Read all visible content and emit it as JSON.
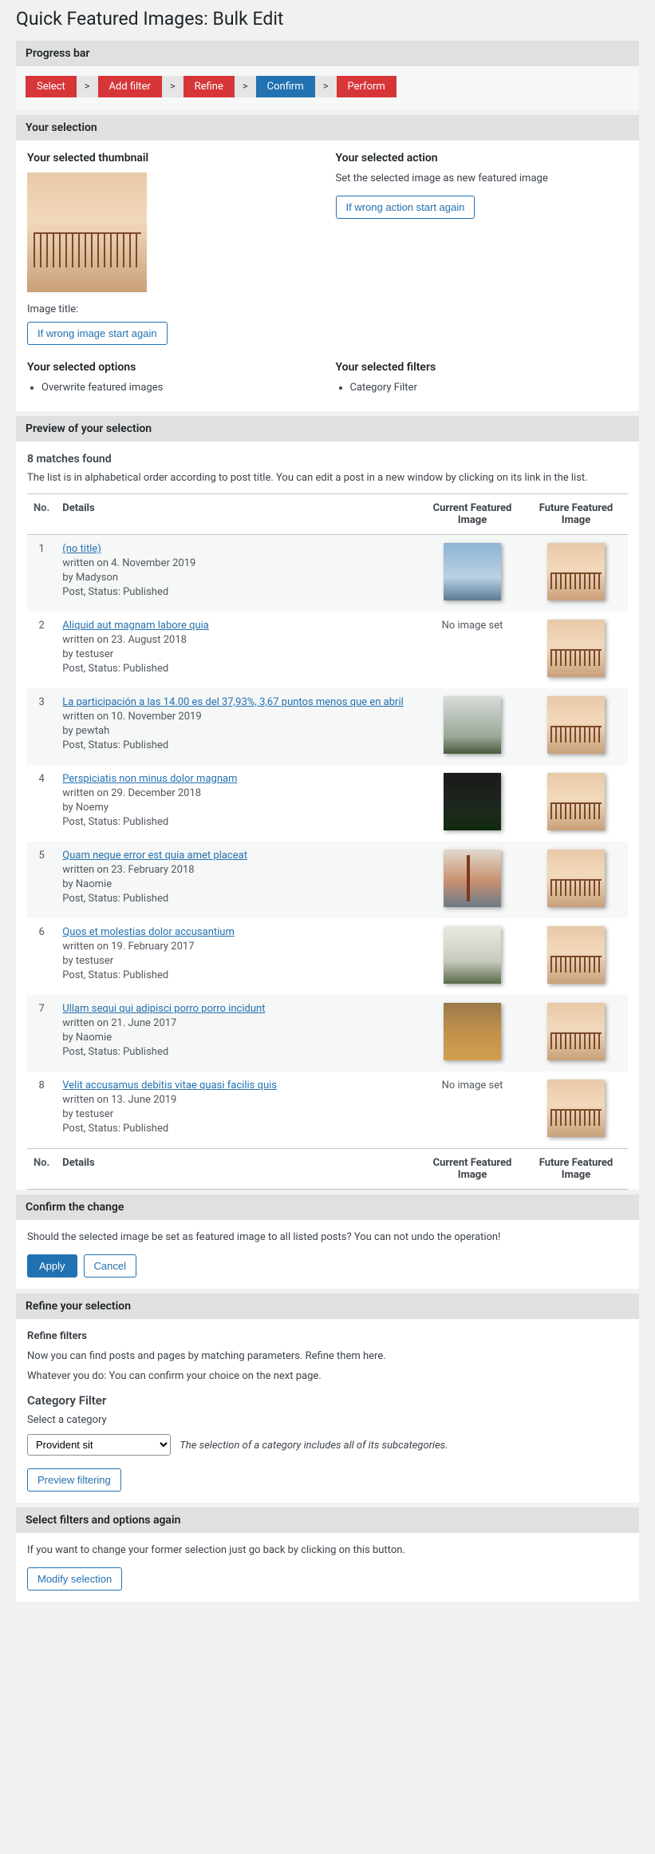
{
  "page_title": "Quick Featured Images: Bulk Edit",
  "progress": {
    "heading": "Progress bar",
    "steps": [
      "Select",
      "Add filter",
      "Refine",
      "Confirm",
      "Perform"
    ],
    "sep": ">",
    "active_index": 3
  },
  "selection": {
    "heading": "Your selection",
    "thumb_heading": "Your selected thumbnail",
    "image_title_label": "Image title:",
    "wrong_image_btn": "If wrong image start again",
    "action_heading": "Your selected action",
    "action_desc": "Set the selected image as new featured image",
    "wrong_action_btn": "If wrong action start again",
    "options_heading": "Your selected options",
    "options": [
      "Overwrite featured images"
    ],
    "filters_heading": "Your selected filters",
    "filters": [
      "Category Filter"
    ]
  },
  "preview": {
    "heading": "Preview of your selection",
    "matches": "8 matches found",
    "hint": "The list is in alphabetical order according to post title. You can edit a post in a new window by clicking on its link in the list.",
    "col_no": "No.",
    "col_details": "Details",
    "col_current": "Current Featured Image",
    "col_future": "Future Featured Image",
    "no_image": "No image set",
    "rows": [
      {
        "no": "1",
        "title": "(no title)",
        "date": "written on 4. November 2019",
        "by": "by Madyson",
        "status": "Post, Status: Published",
        "current": "sky"
      },
      {
        "no": "2",
        "title": "Aliquid aut magnam labore quia",
        "date": "written on 23. August 2018",
        "by": "by testuser",
        "status": "Post, Status: Published",
        "current": null
      },
      {
        "no": "3",
        "title": "La participación a las 14.00 es del 37,93%, 3,67 puntos menos que en abril",
        "date": "written on 10. November 2019",
        "by": "by pewtah",
        "status": "Post, Status: Published",
        "current": "fog"
      },
      {
        "no": "4",
        "title": "Perspiciatis non minus dolor magnam",
        "date": "written on 29. December 2018",
        "by": "by Noemy",
        "status": "Post, Status: Published",
        "current": "dark"
      },
      {
        "no": "5",
        "title": "Quam neque error est quia amet placeat",
        "date": "written on 23. February 2018",
        "by": "by Naomie",
        "status": "Post, Status: Published",
        "current": "seg"
      },
      {
        "no": "6",
        "title": "Quos et molestias dolor accusantium",
        "date": "written on 19. February 2017",
        "by": "by testuser",
        "status": "Post, Status: Published",
        "current": "fog2"
      },
      {
        "no": "7",
        "title": "Ullam sequi qui adipisci porro porro incidunt",
        "date": "written on 21. June 2017",
        "by": "by Naomie",
        "status": "Post, Status: Published",
        "current": "autumn"
      },
      {
        "no": "8",
        "title": "Velit accusamus debitis vitae quasi facilis quis",
        "date": "written on 13. June 2019",
        "by": "by testuser",
        "status": "Post, Status: Published",
        "current": null
      }
    ]
  },
  "confirm": {
    "heading": "Confirm the change",
    "text": "Should the selected image be set as featured image to all listed posts? You can not undo the operation!",
    "apply": "Apply",
    "cancel": "Cancel"
  },
  "refine": {
    "heading": "Refine your selection",
    "sub": "Refine filters",
    "p1": "Now you can find posts and pages by matching parameters. Refine them here.",
    "p2": "Whatever you do: You can confirm your choice on the next page.",
    "cat_heading": "Category Filter",
    "cat_label": "Select a category",
    "cat_selected": "Provident sit",
    "cat_note": "The selection of a category includes all of its subcategories.",
    "preview_btn": "Preview filtering"
  },
  "again": {
    "heading": "Select filters and options again",
    "text": "If you want to change your former selection just go back by clicking on this button.",
    "btn": "Modify selection"
  }
}
